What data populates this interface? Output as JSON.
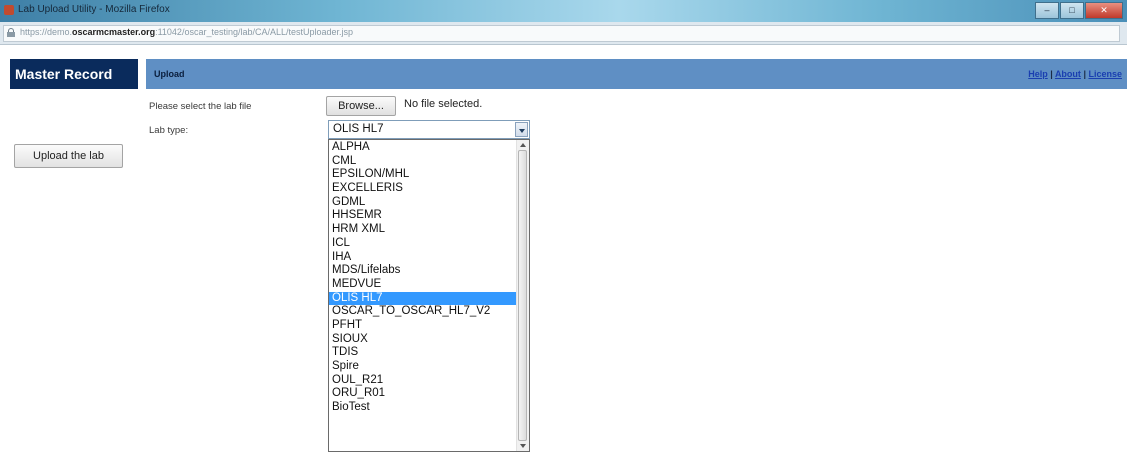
{
  "window": {
    "title": "Lab Upload Utility - Mozilla Firefox",
    "controls": [
      "–",
      "□",
      "✕"
    ]
  },
  "address_bar": {
    "url_prefix": "https://demo.",
    "url_domain": "oscarmcmaster.org",
    "url_path": ":11042/oscar_testing/lab/CA/ALL/testUploader.jsp"
  },
  "header": {
    "brand": "Master Record",
    "section": "Upload",
    "links": [
      "Help",
      "About",
      "License"
    ],
    "separator": " | "
  },
  "form": {
    "upload_button": "Upload the lab",
    "file_label": "Please select the lab file",
    "browse_button": "Browse...",
    "file_status": "No file selected.",
    "lab_type_label": "Lab type:",
    "lab_type_selected": "OLIS HL7",
    "lab_type_options": [
      "ALPHA",
      "CML",
      "EPSILON/MHL",
      "EXCELLERIS",
      "GDML",
      "HHSEMR",
      "HRM XML",
      "ICL",
      "IHA",
      "MDS/Lifelabs",
      "MEDVUE",
      "OLIS HL7",
      "OSCAR_TO_OSCAR_HL7_V2",
      "PFHT",
      "SIOUX",
      "TDIS",
      "Spire",
      "OUL_R21",
      "ORU_R01",
      "BioTest"
    ],
    "highlighted_option_index": 11
  },
  "colors": {
    "brand_bg": "#0a2b5c",
    "header_strip": "#5f8fc4",
    "highlight": "#3399ff"
  }
}
